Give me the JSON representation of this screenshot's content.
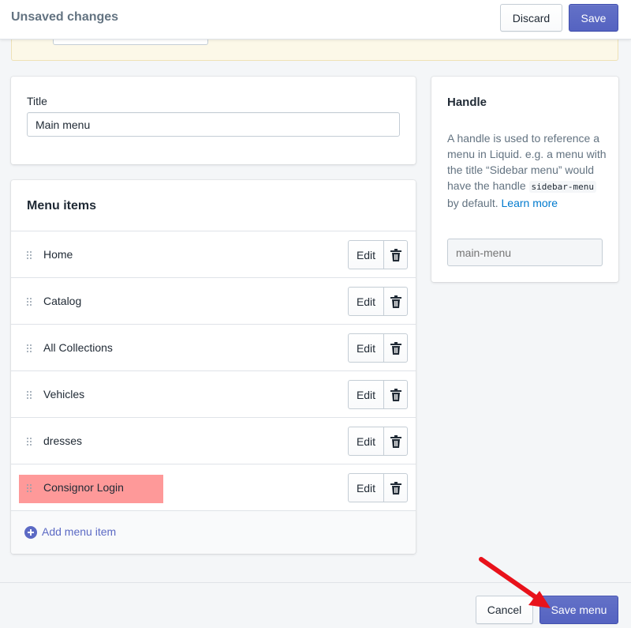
{
  "topbar": {
    "title": "Unsaved changes",
    "discard_label": "Discard",
    "save_label": "Save"
  },
  "title_card": {
    "label": "Title",
    "value": "Main menu"
  },
  "menu": {
    "heading": "Menu items",
    "items": [
      {
        "name": "Home",
        "edit_label": "Edit"
      },
      {
        "name": "Catalog",
        "edit_label": "Edit"
      },
      {
        "name": "All Collections",
        "edit_label": "Edit"
      },
      {
        "name": "Vehicles",
        "edit_label": "Edit"
      },
      {
        "name": "dresses",
        "edit_label": "Edit"
      },
      {
        "name": "Consignor Login",
        "edit_label": "Edit",
        "highlighted": true
      }
    ],
    "add_label": "Add menu item"
  },
  "handle": {
    "heading": "Handle",
    "desc_part1": "A handle is used to reference a menu in Liquid. e.g. a menu with the title “Sidebar menu” would have the handle ",
    "code": "sidebar-menu",
    "desc_part2": " by default. ",
    "learn_more": "Learn more",
    "placeholder": "main-menu"
  },
  "footer": {
    "cancel_label": "Cancel",
    "save_menu_label": "Save menu"
  },
  "colors": {
    "primary": "#5c6ac4",
    "highlight": "#fe9999",
    "arrow": "#e8121b"
  }
}
